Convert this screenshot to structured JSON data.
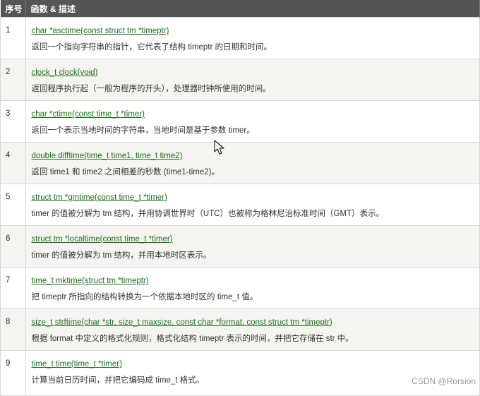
{
  "header": {
    "no": "序号",
    "desc": "函数 & 描述"
  },
  "rows": [
    {
      "no": "1",
      "sig": "char *asctime(const struct tm *timeptr)",
      "text": "返回一个指向字符串的指针，它代表了结构 timeptr 的日期和时间。"
    },
    {
      "no": "2",
      "sig": "clock_t clock(void)",
      "text": "返回程序执行起（一般为程序的开头），处理器时钟所使用的时间。"
    },
    {
      "no": "3",
      "sig": "char *ctime(const time_t *timer)",
      "text": "返回一个表示当地时间的字符串，当地时间是基于参数 timer。"
    },
    {
      "no": "4",
      "sig": "double difftime(time_t time1, time_t time2)",
      "text": "返回 time1 和 time2 之间相差的秒数 (time1-time2)。"
    },
    {
      "no": "5",
      "sig": "struct tm *gmtime(const time_t *timer)",
      "text": "timer 的值被分解为 tm 结构，并用协调世界时（UTC）也被称为格林尼治标准时间（GMT）表示。"
    },
    {
      "no": "6",
      "sig": "struct tm *localtime(const time_t *timer)",
      "text": "timer 的值被分解为 tm 结构，并用本地时区表示。"
    },
    {
      "no": "7",
      "sig": "time_t mktime(struct tm *timeptr)",
      "text": "把 timeptr 所指向的结构转换为一个依据本地时区的 time_t 值。"
    },
    {
      "no": "8",
      "sig": "size_t strftime(char *str, size_t maxsize, const char *format, const struct tm *timeptr)",
      "text": "根据 format 中定义的格式化规则，格式化结构 timeptr 表示的时间，并把它存储在 str 中。"
    },
    {
      "no": "9",
      "sig": "time_t time(time_t *timer)",
      "text": "计算当前日历时间，并把它编码成 time_t 格式。"
    }
  ],
  "watermark": "CSDN @Rorsion",
  "colors": {
    "header_bg": "#555555",
    "link": "#1f6f1f",
    "alt_row": "#f6f4f0",
    "border": "#d6d6d6"
  },
  "icons": {
    "cursor": "mouse-pointer-icon"
  }
}
